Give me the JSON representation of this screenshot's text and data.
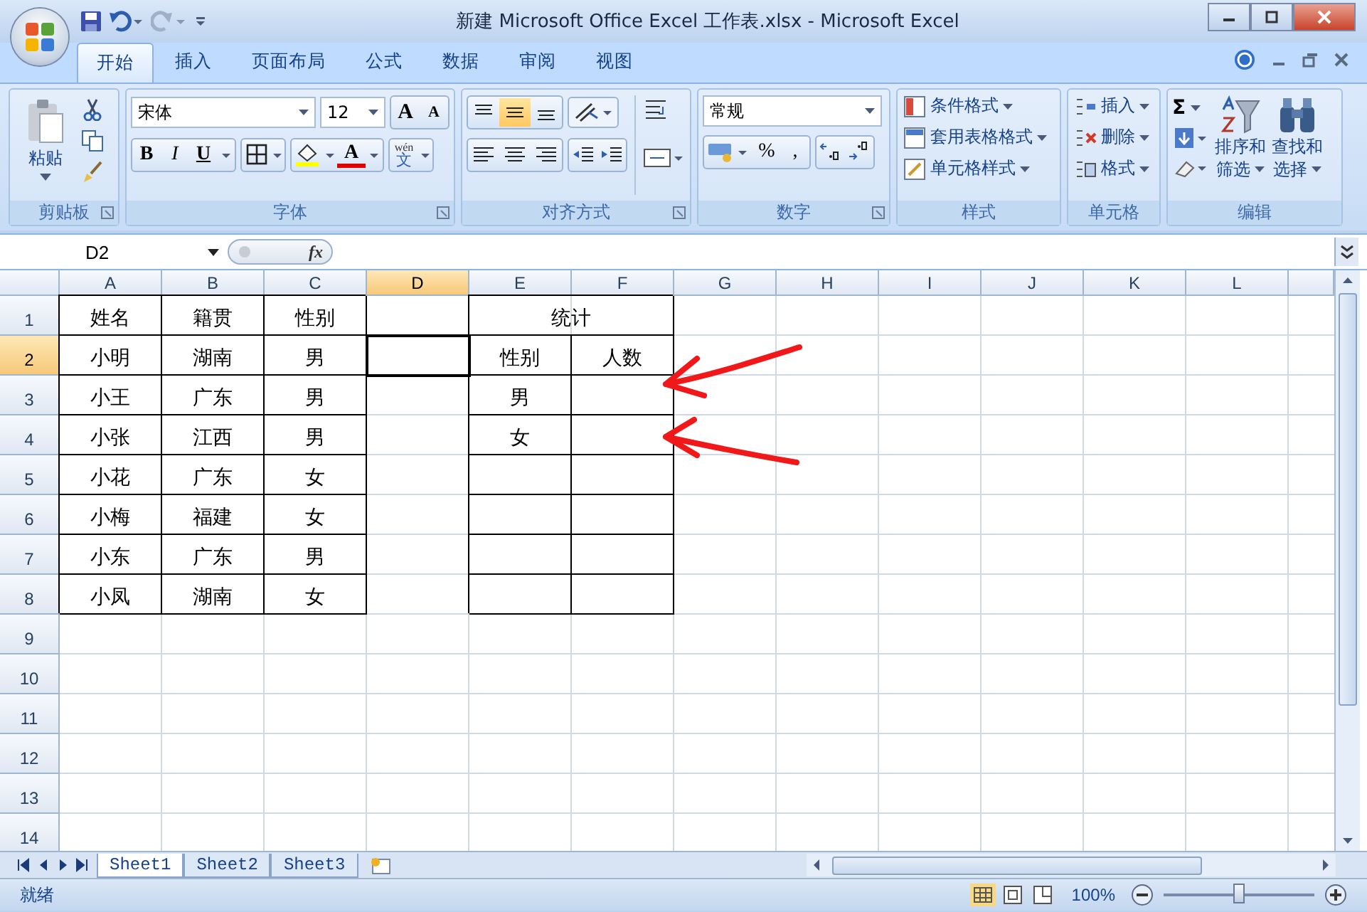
{
  "window": {
    "title": "新建 Microsoft Office Excel 工作表.xlsx - Microsoft Excel"
  },
  "ribbon_tabs": [
    {
      "label": "开始",
      "selected": true
    },
    {
      "label": "插入",
      "selected": false
    },
    {
      "label": "页面布局",
      "selected": false
    },
    {
      "label": "公式",
      "selected": false
    },
    {
      "label": "数据",
      "selected": false
    },
    {
      "label": "审阅",
      "selected": false
    },
    {
      "label": "视图",
      "selected": false
    }
  ],
  "clipboard": {
    "title": "剪贴板",
    "paste": "粘贴"
  },
  "font": {
    "title": "字体",
    "name": "宋体",
    "size": "12",
    "size_buttons": [
      "A",
      "A"
    ],
    "style_buttons": [
      {
        "label": "B",
        "kind": "bold"
      },
      {
        "label": "I",
        "kind": "italic"
      },
      {
        "label": "U",
        "kind": "underline"
      }
    ],
    "color_letter": "A",
    "phonetic": [
      "wén",
      "文"
    ]
  },
  "alignment": {
    "title": "对齐方式",
    "vertical_align": [
      {
        "kind": "top",
        "selected": false
      },
      {
        "kind": "middle",
        "selected": true
      },
      {
        "kind": "bottom",
        "selected": false
      }
    ]
  },
  "number": {
    "title": "数字",
    "format": "常规",
    "percent": "%",
    "comma": ","
  },
  "styles": {
    "title": "样式",
    "items": [
      "条件格式",
      "套用表格格式",
      "单元格样式"
    ]
  },
  "cells": {
    "title": "单元格",
    "items": [
      "插入",
      "删除",
      "格式"
    ]
  },
  "editing": {
    "title": "编辑",
    "sum": "Σ",
    "sort": [
      "排序和",
      "筛选"
    ],
    "find": [
      "查找和",
      "选择"
    ]
  },
  "formula_bar": {
    "name_box": "D2",
    "fx": "fx"
  },
  "columns": [
    {
      "label": "A",
      "selected": false
    },
    {
      "label": "B",
      "selected": false
    },
    {
      "label": "C",
      "selected": false
    },
    {
      "label": "D",
      "selected": true
    },
    {
      "label": "E",
      "selected": false
    },
    {
      "label": "F",
      "selected": false
    },
    {
      "label": "G",
      "selected": false
    },
    {
      "label": "H",
      "selected": false
    },
    {
      "label": "I",
      "selected": false
    },
    {
      "label": "J",
      "selected": false
    },
    {
      "label": "K",
      "selected": false
    },
    {
      "label": "L",
      "selected": false
    }
  ],
  "rows": [
    {
      "number": "1",
      "selected": false,
      "cells": [
        {
          "text": "姓名",
          "bordered": true
        },
        {
          "text": "籍贯",
          "bordered": true
        },
        {
          "text": "性别",
          "bordered": true
        },
        {
          "bordered": false
        },
        {
          "text": "统计",
          "bordered": true,
          "kind": "merged"
        }
      ]
    },
    {
      "number": "2",
      "selected": true,
      "cells": [
        {
          "text": "小明",
          "bordered": true
        },
        {
          "text": "湖南",
          "bordered": true
        },
        {
          "text": "男",
          "bordered": true
        },
        {
          "bordered": false,
          "selected": true
        },
        {
          "text": "性别",
          "bordered": true
        },
        {
          "text": "人数",
          "bordered": true
        }
      ]
    },
    {
      "number": "3",
      "selected": false,
      "cells": [
        {
          "text": "小王",
          "bordered": true
        },
        {
          "text": "广东",
          "bordered": true
        },
        {
          "text": "男",
          "bordered": true
        },
        {
          "bordered": false
        },
        {
          "text": "男",
          "bordered": true
        },
        {
          "bordered": true
        }
      ]
    },
    {
      "number": "4",
      "selected": false,
      "cells": [
        {
          "text": "小张",
          "bordered": true
        },
        {
          "text": "江西",
          "bordered": true
        },
        {
          "text": "男",
          "bordered": true
        },
        {
          "bordered": false
        },
        {
          "text": "女",
          "bordered": true
        },
        {
          "bordered": true
        }
      ]
    },
    {
      "number": "5",
      "selected": false,
      "cells": [
        {
          "text": "小花",
          "bordered": true
        },
        {
          "text": "广东",
          "bordered": true
        },
        {
          "text": "女",
          "bordered": true
        },
        {
          "bordered": false
        },
        {
          "bordered": true
        },
        {
          "bordered": true
        }
      ]
    },
    {
      "number": "6",
      "selected": false,
      "cells": [
        {
          "text": "小梅",
          "bordered": true
        },
        {
          "text": "福建",
          "bordered": true
        },
        {
          "text": "女",
          "bordered": true
        },
        {
          "bordered": false
        },
        {
          "bordered": true
        },
        {
          "bordered": true
        }
      ]
    },
    {
      "number": "7",
      "selected": false,
      "cells": [
        {
          "text": "小东",
          "bordered": true
        },
        {
          "text": "广东",
          "bordered": true
        },
        {
          "text": "男",
          "bordered": true
        },
        {
          "bordered": false
        },
        {
          "bordered": true
        },
        {
          "bordered": true
        }
      ]
    },
    {
      "number": "8",
      "selected": false,
      "cells": [
        {
          "text": "小凤",
          "bordered": true
        },
        {
          "text": "湖南",
          "bordered": true
        },
        {
          "text": "女",
          "bordered": true
        },
        {
          "bordered": false
        },
        {
          "bordered": true
        },
        {
          "bordered": true
        }
      ]
    },
    {
      "number": "9",
      "selected": false
    },
    {
      "number": "10",
      "selected": false
    },
    {
      "number": "11",
      "selected": false
    },
    {
      "number": "12",
      "selected": false
    },
    {
      "number": "13",
      "selected": false
    },
    {
      "number": "14",
      "selected": false
    }
  ],
  "sheet_tabs": [
    {
      "label": "Sheet1",
      "selected": true
    },
    {
      "label": "Sheet2",
      "selected": false
    },
    {
      "label": "Sheet3",
      "selected": false
    }
  ],
  "status_bar": {
    "status": "就绪",
    "zoom": "100%",
    "zoom_slider": {
      "level": 0.5
    }
  }
}
